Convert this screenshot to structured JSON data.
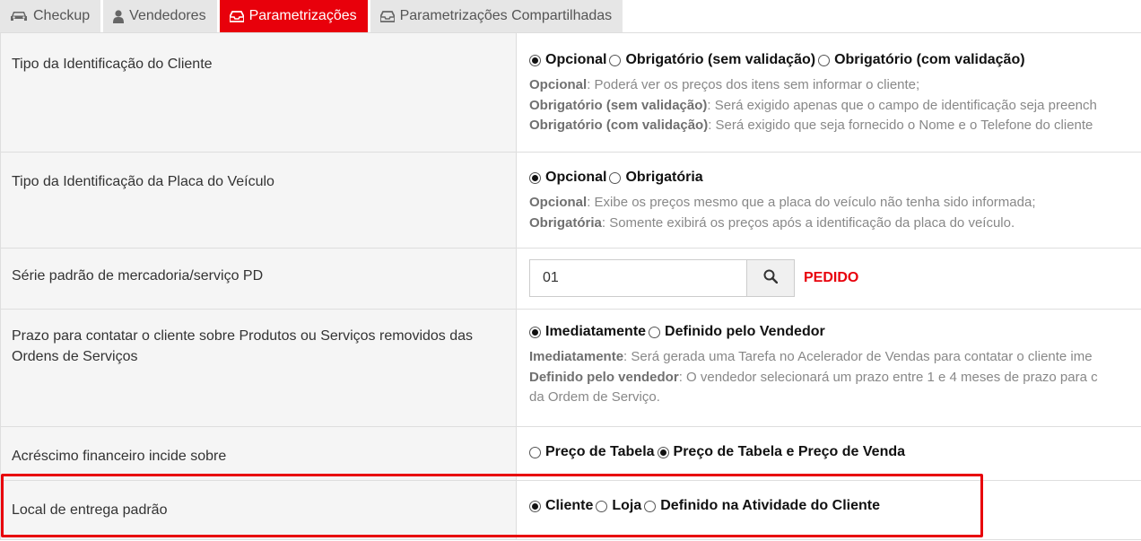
{
  "tabs": [
    {
      "label": "Checkup",
      "icon": "car-icon"
    },
    {
      "label": "Vendedores",
      "icon": "user-icon"
    },
    {
      "label": "Parametrizações",
      "icon": "inbox-icon"
    },
    {
      "label": "Parametrizações Compartilhadas",
      "icon": "inbox-icon"
    }
  ],
  "rows": {
    "cliente_id": {
      "label": "Tipo da Identificação do Cliente",
      "options": [
        "Opcional",
        "Obrigatório (sem validação)",
        "Obrigatório (com validação)"
      ],
      "selected": "Opcional",
      "desc": [
        {
          "term": "Opcional",
          "text": ": Poderá ver os preços dos itens sem informar o cliente;"
        },
        {
          "term": "Obrigatório (sem validação)",
          "text": ": Será exigido apenas que o campo de identificação seja preench"
        },
        {
          "term": "Obrigatório (com validação)",
          "text": ": Será exigido que seja fornecido o Nome e o Telefone do cliente"
        }
      ]
    },
    "placa": {
      "label": "Tipo da Identificação da Placa do Veículo",
      "options": [
        "Opcional",
        "Obrigatória"
      ],
      "selected": "Opcional",
      "desc": [
        {
          "term": "Opcional",
          "text": ": Exibe os preços mesmo que a placa do veículo não tenha sido informada;"
        },
        {
          "term": "Obrigatória",
          "text": ": Somente exibirá os preços após a identificação da placa do veículo."
        }
      ]
    },
    "serie": {
      "label": "Série padrão de mercadoria/serviço PD",
      "value": "01",
      "tag": "PEDIDO",
      "icon": "search-icon"
    },
    "prazo": {
      "label": "Prazo para contatar o cliente sobre Produtos ou Serviços removidos das Ordens de Serviços",
      "options": [
        "Imediatamente",
        "Definido pelo Vendedor"
      ],
      "selected": "Imediatamente",
      "desc": [
        {
          "term": "Imediatamente",
          "text": ": Será gerada uma Tarefa no Acelerador de Vendas para contatar o cliente ime"
        },
        {
          "term": "Definido pelo vendedor",
          "text": ": O vendedor selecionará um prazo entre 1 e 4 meses de prazo para c"
        },
        {
          "term": "",
          "text": "da Ordem de Serviço."
        }
      ]
    },
    "acrescimo": {
      "label": "Acréscimo financeiro incide sobre",
      "options": [
        "Preço de Tabela",
        "Preço de Tabela e Preço de Venda"
      ],
      "selected": "Preço de Tabela e Preço de Venda"
    },
    "entrega": {
      "label": "Local de entrega padrão",
      "options": [
        "Cliente",
        "Loja",
        "Definido na Atividade do Cliente"
      ],
      "selected": "Cliente"
    }
  },
  "colors": {
    "accent": "#e8000b",
    "label_bg": "#f5f5f5",
    "tab_bg": "#e6e6e6"
  }
}
